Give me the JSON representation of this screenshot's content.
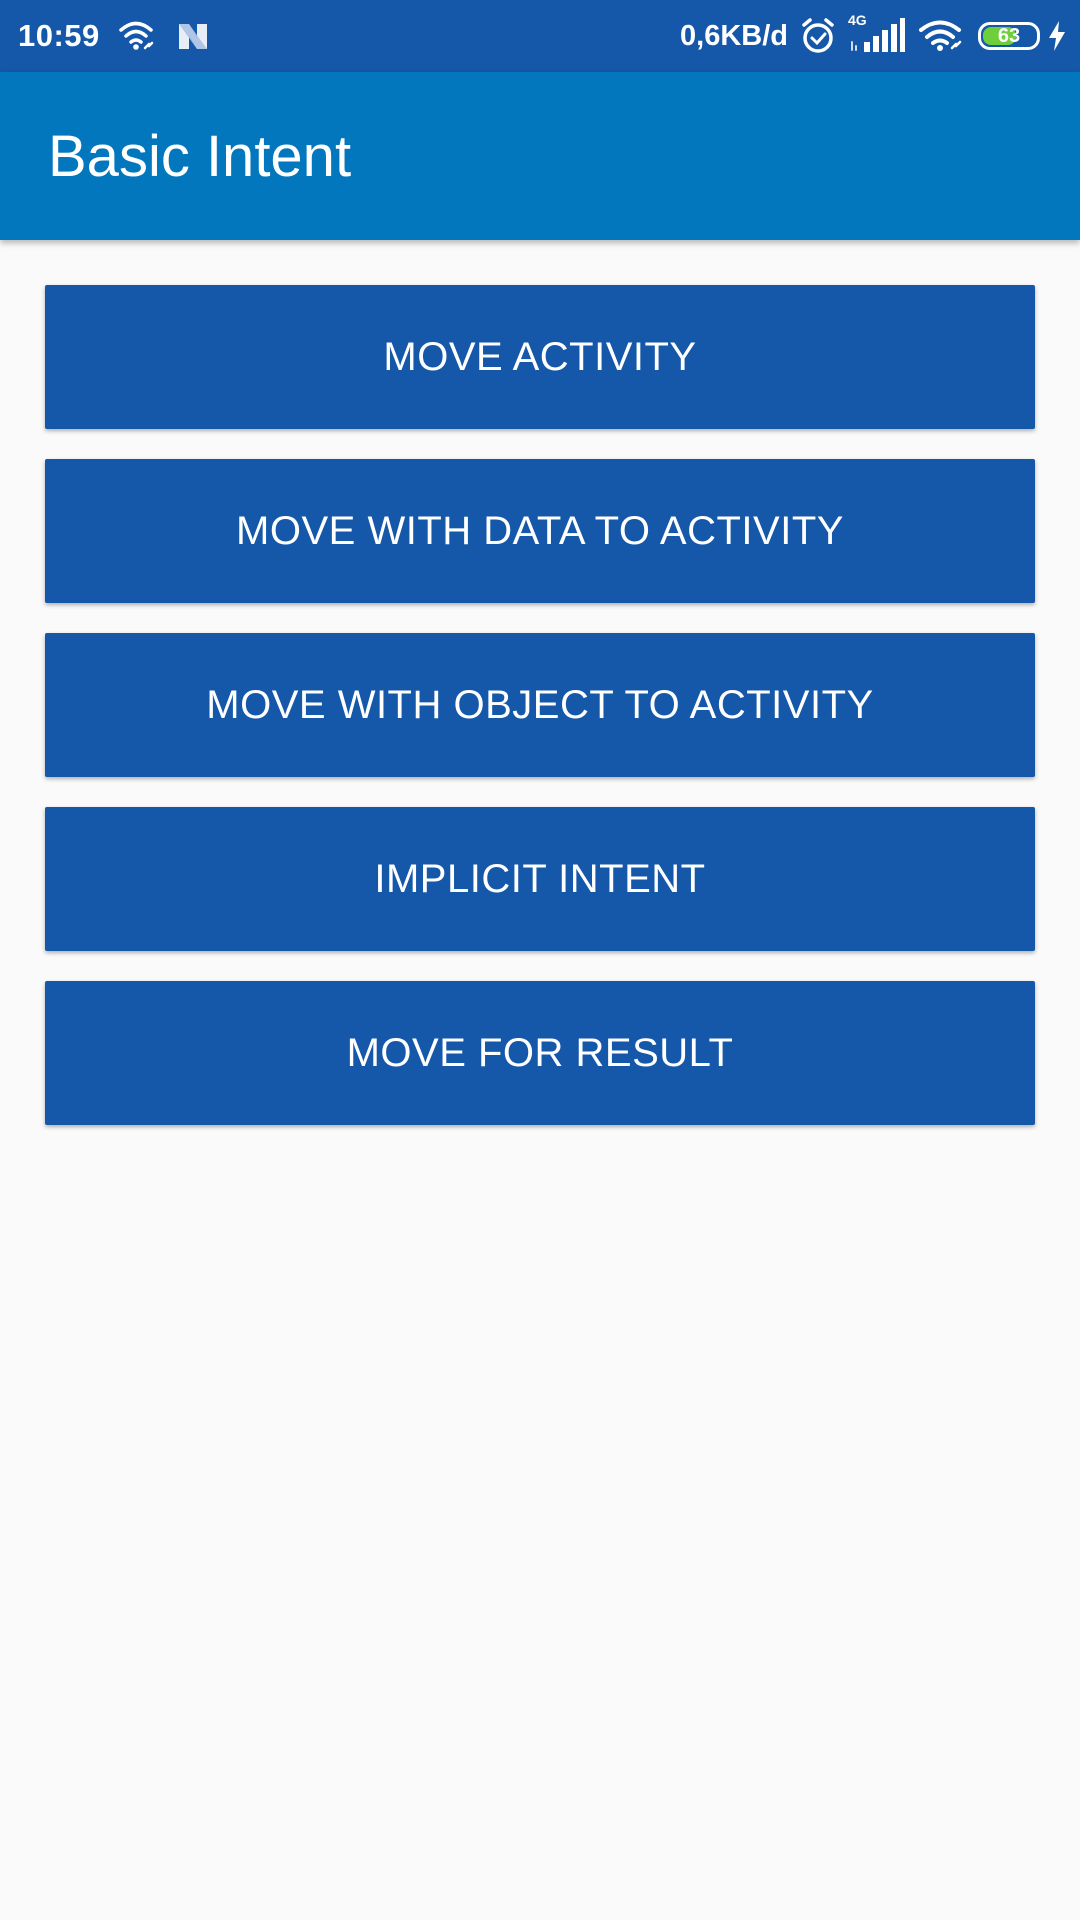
{
  "status_bar": {
    "time": "10:59",
    "data_speed": "0,6KB/d",
    "network_type": "4G",
    "battery_level": "63",
    "battery_fraction": 0.63,
    "icons": [
      "wifi-link-icon",
      "n-app-icon",
      "alarm-clock-icon",
      "signal-bars-icon",
      "wifi-icon",
      "battery-icon",
      "charging-bolt-icon"
    ]
  },
  "app_bar": {
    "title": "Basic Intent"
  },
  "buttons": [
    "MOVE ACTIVITY",
    "MOVE WITH DATA TO ACTIVITY",
    "MOVE WITH OBJECT TO ACTIVITY",
    "IMPLICIT INTENT",
    "MOVE FOR RESULT"
  ],
  "colors": {
    "status_bar": "#1557a8",
    "app_bar": "#0277bd",
    "button": "#1557a8",
    "background": "#fafafa",
    "battery_fill": "#6fcf3b"
  }
}
